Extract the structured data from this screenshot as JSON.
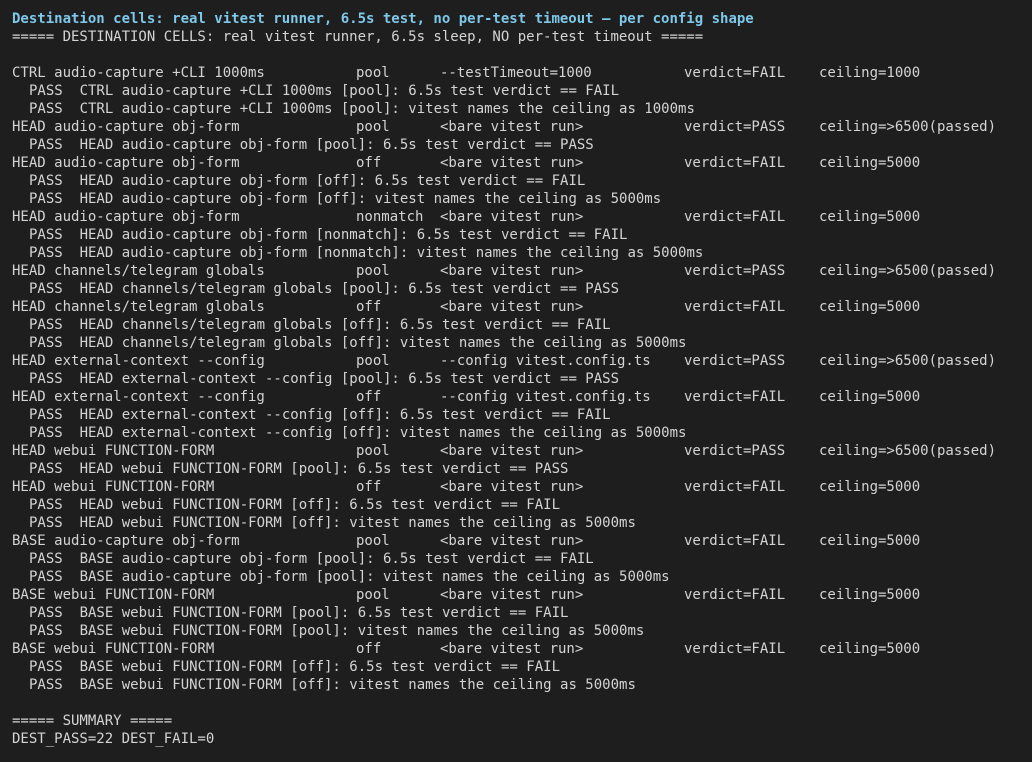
{
  "title": "Destination cells: real vitest runner, 6.5s test, no per-test timeout — per config shape",
  "banner": "===== DESTINATION CELLS: real vitest runner, 6.5s sleep, NO per-test timeout =====",
  "rows": [
    {
      "name": "CTRL audio-capture +CLI 1000ms",
      "mode": "pool",
      "args": "--testTimeout=1000",
      "verdict": "verdict=FAIL",
      "ceiling": "ceiling=1000",
      "checks": [
        "PASS  CTRL audio-capture +CLI 1000ms [pool]: 6.5s test verdict == FAIL",
        "PASS  CTRL audio-capture +CLI 1000ms [pool]: vitest names the ceiling as 1000ms"
      ]
    },
    {
      "name": "HEAD audio-capture obj-form",
      "mode": "pool",
      "args": "<bare vitest run>",
      "verdict": "verdict=PASS",
      "ceiling": "ceiling=>6500(passed)",
      "checks": [
        "PASS  HEAD audio-capture obj-form [pool]: 6.5s test verdict == PASS"
      ]
    },
    {
      "name": "HEAD audio-capture obj-form",
      "mode": "off",
      "args": "<bare vitest run>",
      "verdict": "verdict=FAIL",
      "ceiling": "ceiling=5000",
      "checks": [
        "PASS  HEAD audio-capture obj-form [off]: 6.5s test verdict == FAIL",
        "PASS  HEAD audio-capture obj-form [off]: vitest names the ceiling as 5000ms"
      ]
    },
    {
      "name": "HEAD audio-capture obj-form",
      "mode": "nonmatch",
      "args": "<bare vitest run>",
      "verdict": "verdict=FAIL",
      "ceiling": "ceiling=5000",
      "checks": [
        "PASS  HEAD audio-capture obj-form [nonmatch]: 6.5s test verdict == FAIL",
        "PASS  HEAD audio-capture obj-form [nonmatch]: vitest names the ceiling as 5000ms"
      ]
    },
    {
      "name": "HEAD channels/telegram globals",
      "mode": "pool",
      "args": "<bare vitest run>",
      "verdict": "verdict=PASS",
      "ceiling": "ceiling=>6500(passed)",
      "checks": [
        "PASS  HEAD channels/telegram globals [pool]: 6.5s test verdict == PASS"
      ]
    },
    {
      "name": "HEAD channels/telegram globals",
      "mode": "off",
      "args": "<bare vitest run>",
      "verdict": "verdict=FAIL",
      "ceiling": "ceiling=5000",
      "checks": [
        "PASS  HEAD channels/telegram globals [off]: 6.5s test verdict == FAIL",
        "PASS  HEAD channels/telegram globals [off]: vitest names the ceiling as 5000ms"
      ]
    },
    {
      "name": "HEAD external-context --config",
      "mode": "pool",
      "args": "--config vitest.config.ts",
      "verdict": "verdict=PASS",
      "ceiling": "ceiling=>6500(passed)",
      "checks": [
        "PASS  HEAD external-context --config [pool]: 6.5s test verdict == PASS"
      ]
    },
    {
      "name": "HEAD external-context --config",
      "mode": "off",
      "args": "--config vitest.config.ts",
      "verdict": "verdict=FAIL",
      "ceiling": "ceiling=5000",
      "checks": [
        "PASS  HEAD external-context --config [off]: 6.5s test verdict == FAIL",
        "PASS  HEAD external-context --config [off]: vitest names the ceiling as 5000ms"
      ]
    },
    {
      "name": "HEAD webui FUNCTION-FORM",
      "mode": "pool",
      "args": "<bare vitest run>",
      "verdict": "verdict=PASS",
      "ceiling": "ceiling=>6500(passed)",
      "checks": [
        "PASS  HEAD webui FUNCTION-FORM [pool]: 6.5s test verdict == PASS"
      ]
    },
    {
      "name": "HEAD webui FUNCTION-FORM",
      "mode": "off",
      "args": "<bare vitest run>",
      "verdict": "verdict=FAIL",
      "ceiling": "ceiling=5000",
      "checks": [
        "PASS  HEAD webui FUNCTION-FORM [off]: 6.5s test verdict == FAIL",
        "PASS  HEAD webui FUNCTION-FORM [off]: vitest names the ceiling as 5000ms"
      ]
    },
    {
      "name": "BASE audio-capture obj-form",
      "mode": "pool",
      "args": "<bare vitest run>",
      "verdict": "verdict=FAIL",
      "ceiling": "ceiling=5000",
      "checks": [
        "PASS  BASE audio-capture obj-form [pool]: 6.5s test verdict == FAIL",
        "PASS  BASE audio-capture obj-form [pool]: vitest names the ceiling as 5000ms"
      ]
    },
    {
      "name": "BASE webui FUNCTION-FORM",
      "mode": "pool",
      "args": "<bare vitest run>",
      "verdict": "verdict=FAIL",
      "ceiling": "ceiling=5000",
      "checks": [
        "PASS  BASE webui FUNCTION-FORM [pool]: 6.5s test verdict == FAIL",
        "PASS  BASE webui FUNCTION-FORM [pool]: vitest names the ceiling as 5000ms"
      ]
    },
    {
      "name": "BASE webui FUNCTION-FORM",
      "mode": "off",
      "args": "<bare vitest run>",
      "verdict": "verdict=FAIL",
      "ceiling": "ceiling=5000",
      "checks": [
        "PASS  BASE webui FUNCTION-FORM [off]: 6.5s test verdict == FAIL",
        "PASS  BASE webui FUNCTION-FORM [off]: vitest names the ceiling as 5000ms"
      ]
    }
  ],
  "summary_header": "===== SUMMARY =====",
  "summary": "DEST_PASS=22 DEST_FAIL=0",
  "colors": {
    "background": "#1e1e1e",
    "text": "#d4d4d4",
    "title": "#7ec8ea"
  }
}
